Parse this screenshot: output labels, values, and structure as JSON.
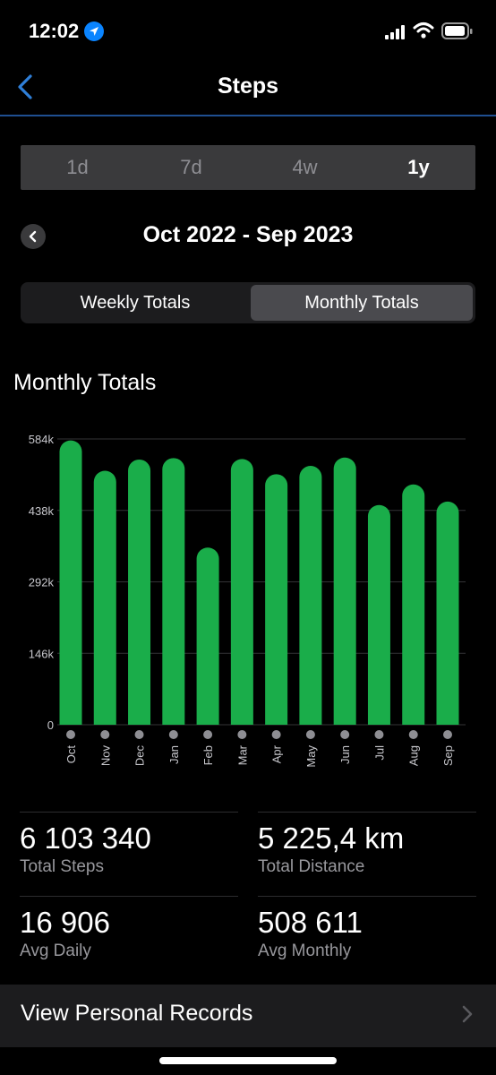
{
  "status_bar": {
    "time": "12:02"
  },
  "nav": {
    "title": "Steps"
  },
  "range_tabs": [
    "1d",
    "7d",
    "4w",
    "1y"
  ],
  "period": {
    "label": "Oct 2022 - Sep 2023"
  },
  "totals_tabs": {
    "weekly": "Weekly Totals",
    "monthly": "Monthly Totals",
    "selected": "Monthly Totals"
  },
  "section": {
    "title": "Monthly Totals"
  },
  "colors": {
    "bar": "#1aad4a",
    "accent_nav": "#1f4f91",
    "location_blue": "#0a84ff"
  },
  "chart_data": {
    "type": "bar",
    "categories": [
      "Oct",
      "Nov",
      "Dec",
      "Jan",
      "Feb",
      "Mar",
      "Apr",
      "May",
      "Jun",
      "Jul",
      "Aug",
      "Sep"
    ],
    "values": [
      581000,
      519000,
      542000,
      545000,
      362000,
      543000,
      512000,
      529000,
      546000,
      449000,
      491000,
      456000
    ],
    "yticks": [
      "584k",
      "438k",
      "292k",
      "146k",
      "0"
    ],
    "ytick_values": [
      584000,
      438000,
      292000,
      146000,
      0
    ],
    "ylim": [
      0,
      584000
    ],
    "grid": true
  },
  "stats": {
    "total_steps": {
      "value": "6 103 340",
      "label": "Total Steps"
    },
    "total_distance": {
      "value": "5 225,4 km",
      "label": "Total Distance"
    },
    "avg_daily": {
      "value": "16 906",
      "label": "Avg Daily"
    },
    "avg_monthly": {
      "value": "508 611",
      "label": "Avg Monthly"
    }
  },
  "records": {
    "label": "View Personal Records"
  }
}
